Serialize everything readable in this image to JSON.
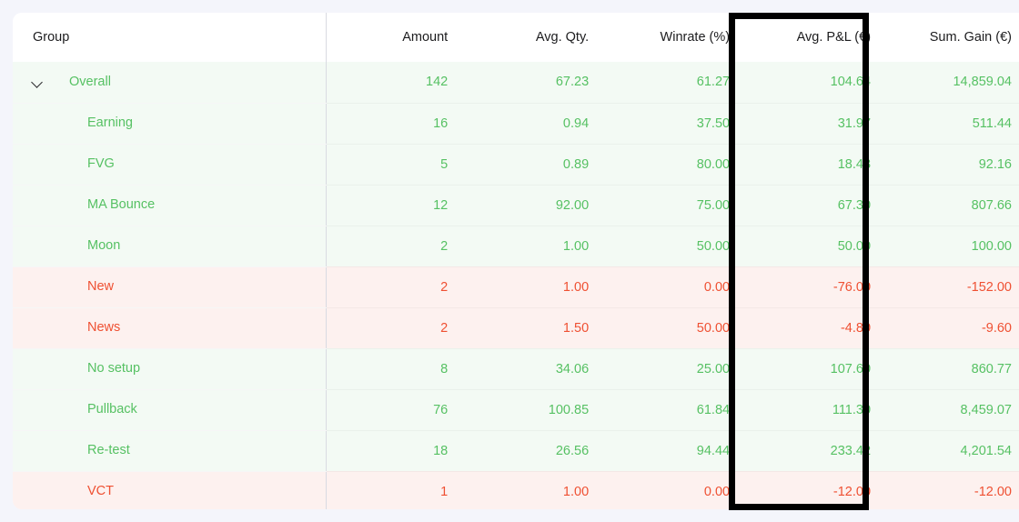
{
  "table": {
    "columns": [
      {
        "key": "group",
        "label": "Group",
        "align": "left"
      },
      {
        "key": "amount",
        "label": "Amount",
        "align": "right"
      },
      {
        "key": "qty",
        "label": "Avg. Qty.",
        "align": "right"
      },
      {
        "key": "win",
        "label": "Winrate (%)",
        "align": "right"
      },
      {
        "key": "pl",
        "label": "Avg. P&L (€)",
        "align": "right"
      },
      {
        "key": "gain",
        "label": "Sum. Gain (€)",
        "align": "right"
      }
    ],
    "rows": [
      {
        "group": "Overall",
        "amount": "142",
        "qty": "67.23",
        "win": "61.27",
        "pl": "104.64",
        "gain": "14,859.04",
        "sentiment": "positive",
        "level": 0,
        "expanded": true,
        "chevron": "chevron-down-icon"
      },
      {
        "group": "Earning",
        "amount": "16",
        "qty": "0.94",
        "win": "37.50",
        "pl": "31.97",
        "gain": "511.44",
        "sentiment": "positive",
        "level": 1,
        "expanded": false,
        "chevron": ""
      },
      {
        "group": "FVG",
        "amount": "5",
        "qty": "0.89",
        "win": "80.00",
        "pl": "18.43",
        "gain": "92.16",
        "sentiment": "positive",
        "level": 1,
        "expanded": false,
        "chevron": ""
      },
      {
        "group": "MA Bounce",
        "amount": "12",
        "qty": "92.00",
        "win": "75.00",
        "pl": "67.30",
        "gain": "807.66",
        "sentiment": "positive",
        "level": 1,
        "expanded": false,
        "chevron": ""
      },
      {
        "group": "Moon",
        "amount": "2",
        "qty": "1.00",
        "win": "50.00",
        "pl": "50.00",
        "gain": "100.00",
        "sentiment": "positive",
        "level": 1,
        "expanded": false,
        "chevron": ""
      },
      {
        "group": "New",
        "amount": "2",
        "qty": "1.00",
        "win": "0.00",
        "pl": "-76.00",
        "gain": "-152.00",
        "sentiment": "negative",
        "level": 1,
        "expanded": false,
        "chevron": ""
      },
      {
        "group": "News",
        "amount": "2",
        "qty": "1.50",
        "win": "50.00",
        "pl": "-4.80",
        "gain": "-9.60",
        "sentiment": "negative",
        "level": 1,
        "expanded": false,
        "chevron": ""
      },
      {
        "group": "No setup",
        "amount": "8",
        "qty": "34.06",
        "win": "25.00",
        "pl": "107.60",
        "gain": "860.77",
        "sentiment": "positive",
        "level": 1,
        "expanded": false,
        "chevron": ""
      },
      {
        "group": "Pullback",
        "amount": "76",
        "qty": "100.85",
        "win": "61.84",
        "pl": "111.30",
        "gain": "8,459.07",
        "sentiment": "positive",
        "level": 1,
        "expanded": false,
        "chevron": ""
      },
      {
        "group": "Re-test",
        "amount": "18",
        "qty": "26.56",
        "win": "94.44",
        "pl": "233.42",
        "gain": "4,201.54",
        "sentiment": "positive",
        "level": 1,
        "expanded": false,
        "chevron": ""
      },
      {
        "group": "VCT",
        "amount": "1",
        "qty": "1.00",
        "win": "0.00",
        "pl": "-12.00",
        "gain": "-12.00",
        "sentiment": "negative",
        "level": 1,
        "expanded": false,
        "chevron": ""
      }
    ]
  },
  "annotation": {
    "highlighted_column": "Avg. P&L (€)",
    "style": "black-rectangle-outline"
  },
  "colors": {
    "positive_text": "#56c163",
    "negative_text": "#ef5032",
    "positive_row_bg": "#f3faf4",
    "negative_row_bg": "#fdf1ef",
    "header_text": "#1c1c1e",
    "card_bg": "#ffffff",
    "page_bg": "#f4f5fb",
    "annotation": "#000000"
  }
}
